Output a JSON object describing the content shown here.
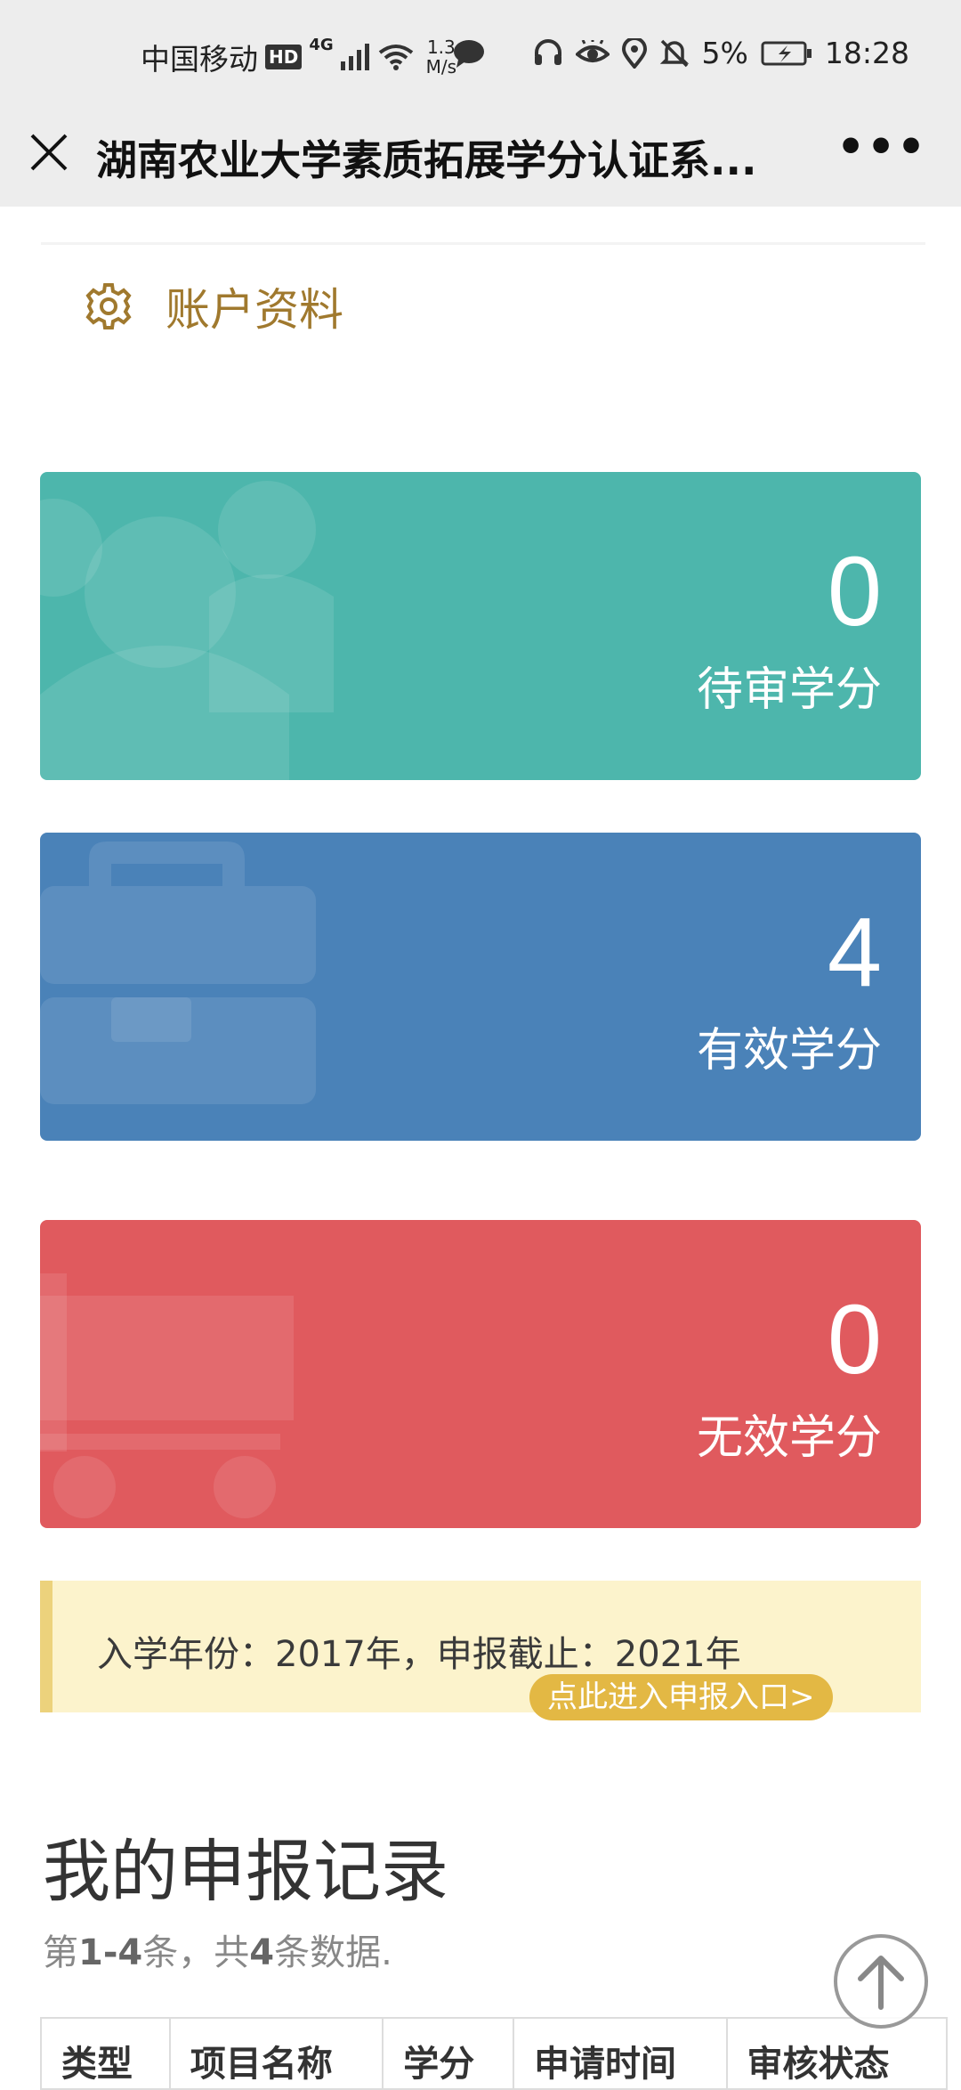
{
  "status_bar": {
    "carrier": "中国移动",
    "hd": "HD",
    "network": "4G",
    "speed_value": "1.3",
    "speed_unit": "M/s",
    "battery": "5%",
    "time": "18:28"
  },
  "header": {
    "title": "湖南农业大学素质拓展学分认证系...",
    "more_label": "•••"
  },
  "account": {
    "label": "账户资料"
  },
  "cards": [
    {
      "value": "0",
      "label": "待审学分",
      "color": "#4db6ac",
      "icon": "users-icon"
    },
    {
      "value": "4",
      "label": "有效学分",
      "color": "#4a82b8",
      "icon": "briefcase-icon"
    },
    {
      "value": "0",
      "label": "无效学分",
      "color": "#e05a5e",
      "icon": "cart-icon"
    }
  ],
  "notice": {
    "text": "入学年份：2017年，申报截止：2021年",
    "button": "点此进入申报入口>"
  },
  "records": {
    "title": "我的申报记录",
    "summary_prefix": "第",
    "summary_range": "1-4",
    "summary_mid": "条，共",
    "summary_total": "4",
    "summary_suffix": "条数据.",
    "columns": [
      "类型",
      "项目名称",
      "学分",
      "申请时间",
      "审核状态"
    ]
  }
}
